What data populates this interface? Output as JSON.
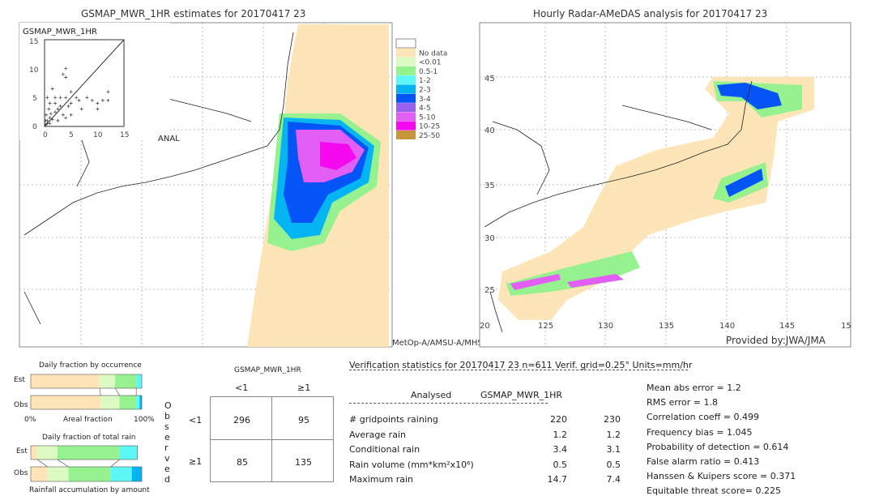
{
  "chart_data": [
    {
      "type": "heatmap",
      "title": "GSMAP_MWR_1HR estimates for 20170417 23",
      "satellite_label": "MetOp-A/AMSU-A/MHS",
      "inset_scatter": {
        "type": "scatter",
        "ylabel": "GSMAP_MWR_1HR",
        "xlabel": "ANAL",
        "xlim": [
          0,
          15
        ],
        "ylim": [
          0,
          15
        ],
        "xticks": [
          "0",
          "5",
          "10",
          "15"
        ],
        "yticks": [
          "0",
          "5",
          "10",
          "15"
        ],
        "diagonal": true,
        "points": [
          [
            0.2,
            0.3
          ],
          [
            0.5,
            1
          ],
          [
            1,
            0.5
          ],
          [
            0.3,
            2
          ],
          [
            1.5,
            1.2
          ],
          [
            2,
            2.5
          ],
          [
            0.8,
            3
          ],
          [
            2.5,
            1
          ],
          [
            3,
            3.5
          ],
          [
            1,
            4
          ],
          [
            2,
            5
          ],
          [
            3,
            5
          ],
          [
            4,
            5
          ],
          [
            1.5,
            6.5
          ],
          [
            0.5,
            5
          ],
          [
            2,
            4
          ],
          [
            3.5,
            2
          ],
          [
            4,
            1.5
          ],
          [
            5,
            4
          ],
          [
            6,
            5
          ],
          [
            6.5,
            4.5
          ],
          [
            8,
            5
          ],
          [
            9,
            4.5
          ],
          [
            10,
            4
          ],
          [
            11,
            4.5
          ],
          [
            12,
            4.5
          ],
          [
            10,
            3
          ],
          [
            7,
            3
          ],
          [
            5,
            6
          ],
          [
            3.5,
            9
          ],
          [
            4,
            8.5
          ],
          [
            4,
            10
          ],
          [
            5,
            2
          ],
          [
            2.5,
            3
          ],
          [
            1,
            1.5
          ],
          [
            0.5,
            0.5
          ],
          [
            0.2,
            1
          ],
          [
            1.2,
            2.2
          ],
          [
            4.5,
            3.5
          ],
          [
            12,
            6
          ]
        ]
      }
    },
    {
      "type": "heatmap",
      "title": "Hourly Radar-AMeDAS analysis for 20170417 23",
      "credit": "Provided by:JWA/JMA",
      "lat_ticks": [
        "45",
        "40",
        "35",
        "30",
        "25"
      ],
      "lon_ticks": [
        "20",
        "125",
        "130",
        "135",
        "140",
        "145",
        "15"
      ]
    }
  ],
  "legend": {
    "items": [
      {
        "label": "",
        "color": "#ffffff"
      },
      {
        "label": "No data",
        "color": "#fde5b7"
      },
      {
        "label": "<0.01",
        "color": "#dcfbc4"
      },
      {
        "label": "0.5-1",
        "color": "#96f28f"
      },
      {
        "label": "1-2",
        "color": "#5ef7f7"
      },
      {
        "label": "2-3",
        "color": "#05b5f3"
      },
      {
        "label": "3-4",
        "color": "#0554f5"
      },
      {
        "label": "4-5",
        "color": "#9862f0"
      },
      {
        "label": "5-10",
        "color": "#e25ef5"
      },
      {
        "label": "10-25",
        "color": "#f50af0"
      },
      {
        "label": "25-50",
        "color": "#c8963c"
      }
    ]
  },
  "fractions": {
    "occurrence_title": "Daily fraction by occurrence",
    "total_title": "Daily fraction of total rain",
    "est_label": "Est",
    "obs_label": "Obs",
    "axis_left": "0%",
    "axis_mid": "Areal fraction",
    "axis_right": "100%",
    "bottom_caption": "Rainfall accumulation by amount",
    "occurrence_est": [
      0.62,
      0.14,
      0.19,
      0.05
    ],
    "occurrence_obs": [
      0.63,
      0.17,
      0.15,
      0.03,
      0.02
    ],
    "total_est": [
      0.06,
      0.18,
      0.56,
      0.16
    ],
    "total_obs": [
      0.15,
      0.19,
      0.38,
      0.19,
      0.09
    ]
  },
  "contingency": {
    "title": "GSMAP_MWR_1HR",
    "col_lt": "<1",
    "col_ge": "≥1",
    "row_lt": "<1",
    "row_ge": "≥1",
    "observed_letters": [
      "O",
      "b",
      "s",
      "e",
      "r",
      "v",
      "e",
      "d"
    ],
    "cells": {
      "a": "296",
      "b": "95",
      "c": "85",
      "d": "135"
    }
  },
  "stats": {
    "header": "Verification statistics for 20170417 23   n=611   Verif. grid=0.25°   Units=mm/hr",
    "col1": "Analysed",
    "col2": "GSMAP_MWR_1HR",
    "rows": [
      {
        "label": "# gridpoints raining",
        "a": "220",
        "b": "230"
      },
      {
        "label": "Average rain",
        "a": "1.2",
        "b": "1.2"
      },
      {
        "label": "Conditional rain",
        "a": "3.4",
        "b": "3.1"
      },
      {
        "label": "Rain volume (mm*km²x10⁶)",
        "a": "0.5",
        "b": "0.5"
      },
      {
        "label": "Maximum rain",
        "a": "14.7",
        "b": "7.4"
      }
    ],
    "scores": [
      "Mean abs error = 1.2",
      "RMS error = 1.8",
      "Correlation coeff = 0.499",
      "Frequency bias = 1.045",
      "Probability of detection = 0.614",
      "False alarm ratio = 0.413",
      "Hanssen & Kuipers score = 0.371",
      "Equitable threat score= 0.225"
    ]
  }
}
